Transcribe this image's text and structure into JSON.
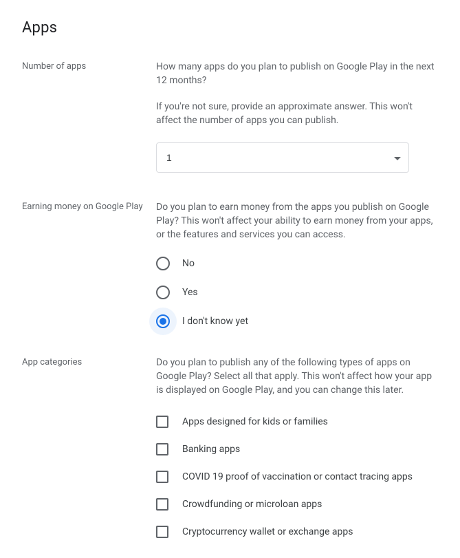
{
  "page_title": "Apps",
  "sections": {
    "number_of_apps": {
      "label": "Number of apps",
      "question": "How many apps do you plan to publish on Google Play in the next 12 months?",
      "hint": "If you're not sure, provide an approximate answer. This won't affect the number of apps you can publish.",
      "selected_value": "1"
    },
    "earning_money": {
      "label": "Earning money on Google Play",
      "question": "Do you plan to earn money from the apps you publish on Google Play? This won't affect your ability to earn money from your apps, or the features and services you can access.",
      "options": {
        "no": "No",
        "yes": "Yes",
        "dont_know": "I don't know yet"
      },
      "selected": "dont_know"
    },
    "app_categories": {
      "label": "App categories",
      "question": "Do you plan to publish any of the following types of apps on Google Play? Select all that apply. This won't affect how your app is displayed on Google Play, and you can change this later.",
      "options": {
        "kids": "Apps designed for kids or families",
        "banking": "Banking apps",
        "covid": "COVID 19 proof of vaccination or contact tracing apps",
        "crowdfunding": "Crowdfunding or microloan apps",
        "crypto": "Cryptocurrency wallet or exchange apps"
      }
    }
  }
}
